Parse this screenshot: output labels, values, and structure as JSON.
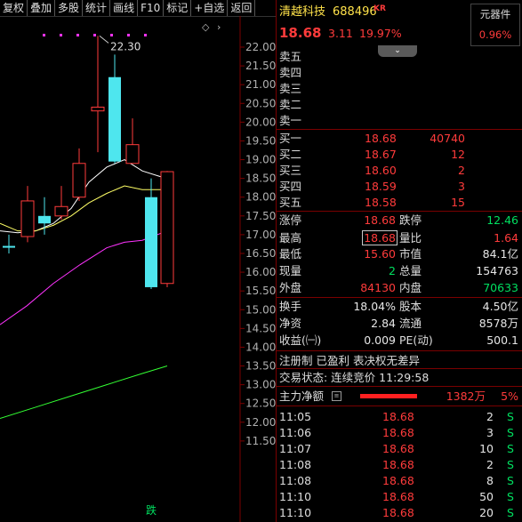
{
  "toolbar": [
    "复权",
    "叠加",
    "多股",
    "统计",
    "画线",
    "F10",
    "标记",
    "+自选",
    "返回"
  ],
  "chart_data": {
    "type": "candlestick",
    "y_ticks": [
      "22.00",
      "21.50",
      "21.00",
      "20.50",
      "20.00",
      "19.50",
      "19.00",
      "18.50",
      "18.00",
      "17.50",
      "17.00",
      "16.50",
      "16.00",
      "15.50",
      "15.00",
      "14.50",
      "14.00",
      "13.50",
      "13.00",
      "12.50",
      "12.00",
      "11.50"
    ],
    "ylim": [
      11.3,
      22.25
    ],
    "candles": [
      {
        "o": 16.7,
        "h": 17.0,
        "l": 16.5,
        "c": 16.7,
        "color": "green"
      },
      {
        "o": 16.95,
        "h": 18.3,
        "l": 16.8,
        "c": 17.9,
        "color": "red"
      },
      {
        "o": 17.5,
        "h": 18.0,
        "l": 17.0,
        "c": 17.3,
        "color": "green"
      },
      {
        "o": 17.5,
        "h": 18.3,
        "l": 17.4,
        "c": 17.75,
        "color": "red"
      },
      {
        "o": 18.0,
        "h": 19.3,
        "l": 17.9,
        "c": 18.9,
        "color": "red"
      },
      {
        "o": 20.3,
        "h": 22.3,
        "l": 19.2,
        "c": 20.4,
        "color": "red"
      },
      {
        "o": 21.2,
        "h": 21.8,
        "l": 18.9,
        "c": 18.95,
        "color": "green"
      },
      {
        "o": 18.9,
        "h": 20.1,
        "l": 18.9,
        "c": 19.4,
        "color": "red"
      },
      {
        "o": 18.0,
        "h": 18.5,
        "l": 15.55,
        "c": 15.6,
        "color": "green"
      },
      {
        "o": 15.7,
        "h": 18.7,
        "l": 15.6,
        "c": 18.68,
        "color": "red"
      }
    ],
    "high_marker": "22.30",
    "down_label": "跌",
    "dots": 7,
    "series_colors": {
      "ma5": "#ffffff",
      "ma10": "#ffff66",
      "ma20": "#ff33ff",
      "ma60": "#33ff33"
    }
  },
  "stock": {
    "name": "清越科技",
    "code": "688496",
    "tag": "KR",
    "price": "18.68",
    "change": "3.11",
    "pct": "19.97%"
  },
  "sector": {
    "name": "元器件",
    "pct": "0.96%"
  },
  "asks": [
    {
      "label": "卖五",
      "price": "",
      "vol": ""
    },
    {
      "label": "卖四",
      "price": "",
      "vol": ""
    },
    {
      "label": "卖三",
      "price": "",
      "vol": ""
    },
    {
      "label": "卖二",
      "price": "",
      "vol": ""
    },
    {
      "label": "卖一",
      "price": "",
      "vol": ""
    }
  ],
  "bids": [
    {
      "label": "买一",
      "price": "18.68",
      "vol": "40740"
    },
    {
      "label": "买二",
      "price": "18.67",
      "vol": "12"
    },
    {
      "label": "买三",
      "price": "18.60",
      "vol": "2"
    },
    {
      "label": "买四",
      "price": "18.59",
      "vol": "3"
    },
    {
      "label": "买五",
      "price": "18.58",
      "vol": "15"
    }
  ],
  "stats": [
    {
      "l1": "涨停",
      "v1": "18.68",
      "c1": "red",
      "l2": "跌停",
      "v2": "12.46",
      "c2": "green"
    },
    {
      "l1": "最高",
      "v1": "18.68",
      "c1": "red",
      "boxed": true,
      "l2": "量比",
      "v2": "1.64",
      "c2": "red"
    },
    {
      "l1": "最低",
      "v1": "15.60",
      "c1": "red",
      "l2": "市值",
      "v2": "84.1亿",
      "c2": "white"
    },
    {
      "l1": "现量",
      "v1": "2",
      "c1": "green",
      "l2": "总量",
      "v2": "154763",
      "c2": "white"
    },
    {
      "l1": "外盘",
      "v1": "84130",
      "c1": "red",
      "l2": "内盘",
      "v2": "70633",
      "c2": "green"
    }
  ],
  "fin": [
    {
      "l1": "换手",
      "v1": "18.04%",
      "l2": "股本",
      "v2": "4.50亿"
    },
    {
      "l1": "净资",
      "v1": "2.84",
      "l2": "流通",
      "v2": "8578万"
    },
    {
      "l1": "收益(㈠)",
      "v1": "0.009",
      "l2": "PE(动)",
      "v2": "500.1"
    }
  ],
  "tags": "注册制 已盈利 表决权无差异",
  "status": "交易状态: 连续竞价 11:29:58",
  "main_flow": {
    "label": "主力净额",
    "value": "1382万",
    "pct": "5%"
  },
  "ticks": [
    {
      "time": "11:05",
      "price": "18.68",
      "vol": "2",
      "side": "S"
    },
    {
      "time": "11:06",
      "price": "18.68",
      "vol": "3",
      "side": "S"
    },
    {
      "time": "11:07",
      "price": "18.68",
      "vol": "10",
      "side": "S"
    },
    {
      "time": "11:08",
      "price": "18.68",
      "vol": "2",
      "side": "S"
    },
    {
      "time": "11:08",
      "price": "18.68",
      "vol": "8",
      "side": "S"
    },
    {
      "time": "11:10",
      "price": "18.68",
      "vol": "50",
      "side": "S"
    },
    {
      "time": "11:10",
      "price": "18.68",
      "vol": "20",
      "side": "S"
    }
  ]
}
